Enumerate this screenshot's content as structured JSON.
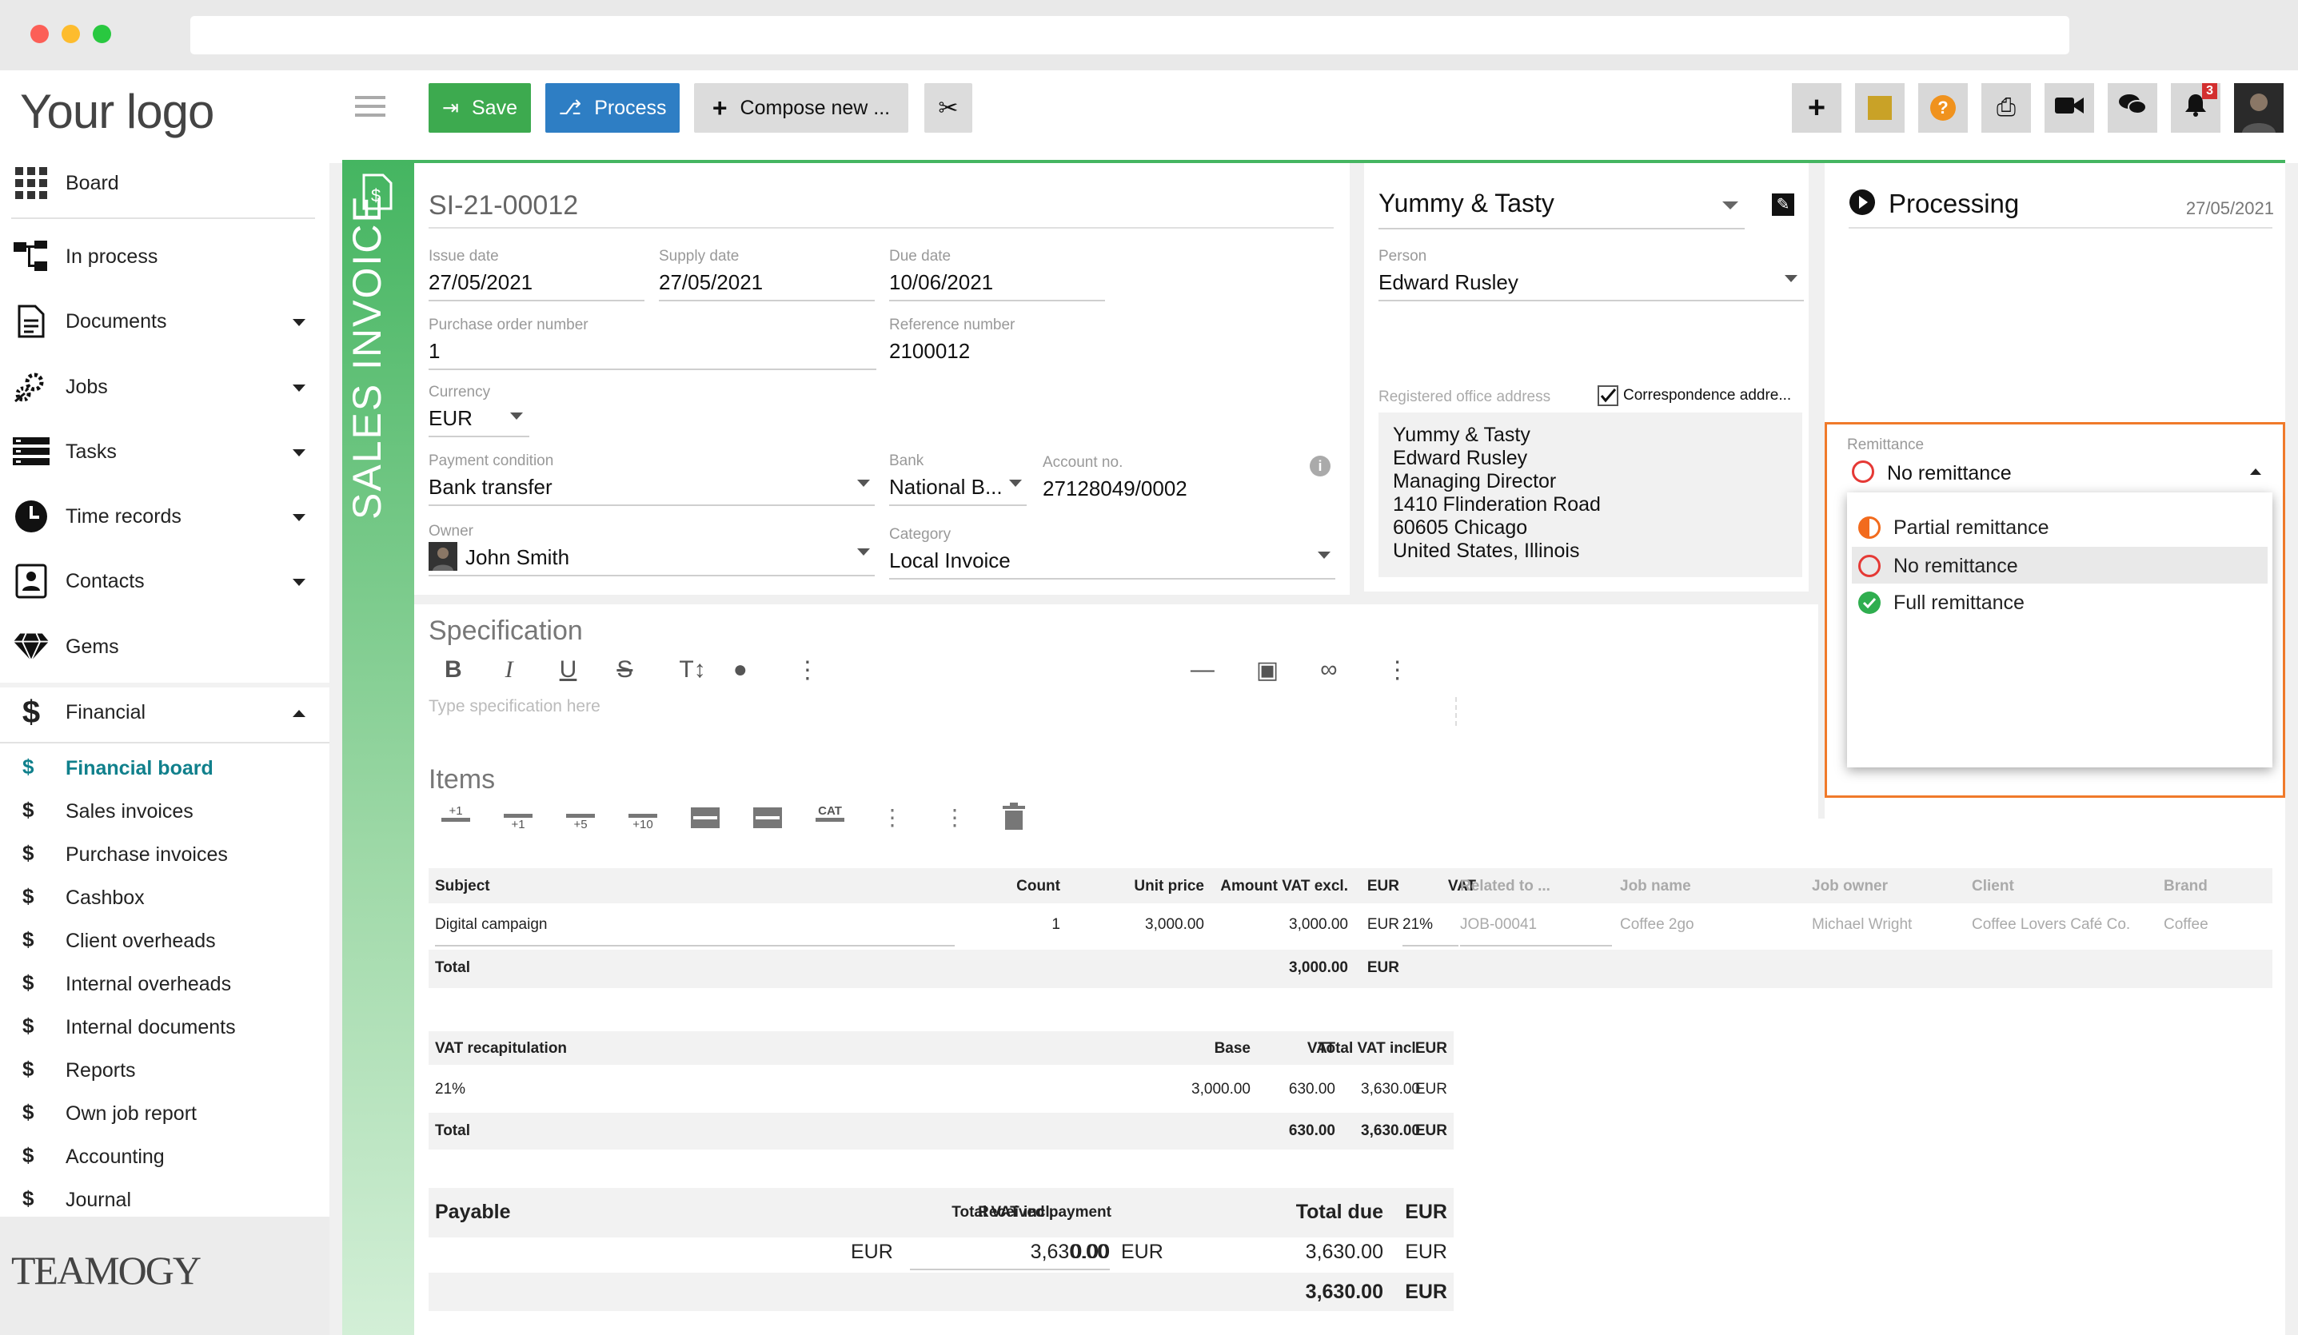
{
  "browser": {
    "url": ""
  },
  "sidebar": {
    "logo": "Your logo",
    "board": "Board",
    "items": [
      {
        "label": "In process",
        "icon": "process-icon"
      },
      {
        "label": "Documents",
        "icon": "document-icon"
      },
      {
        "label": "Jobs",
        "icon": "gears-icon"
      },
      {
        "label": "Tasks",
        "icon": "tasks-icon"
      },
      {
        "label": "Time records",
        "icon": "clock-icon"
      },
      {
        "label": "Contacts",
        "icon": "contacts-icon"
      },
      {
        "label": "Gems",
        "icon": "gem-icon"
      },
      {
        "label": "Financial",
        "icon": "dollar-icon"
      }
    ],
    "financial_items": [
      {
        "label": "Financial board"
      },
      {
        "label": "Sales invoices"
      },
      {
        "label": "Purchase invoices"
      },
      {
        "label": "Cashbox"
      },
      {
        "label": "Client overheads"
      },
      {
        "label": "Internal overheads"
      },
      {
        "label": "Internal documents"
      },
      {
        "label": "Reports"
      },
      {
        "label": "Own job report"
      },
      {
        "label": "Accounting"
      },
      {
        "label": "Journal"
      }
    ],
    "brand": "TEAMOGY"
  },
  "toolbar": {
    "save": "Save",
    "process": "Process",
    "compose": "Compose new ...",
    "notification_count": "3",
    "colors": {
      "save": "#3daa4f",
      "process": "#2e7ec4",
      "compose": "#dcdcdc"
    }
  },
  "invoice": {
    "tab_label": "SALES INVOICE",
    "number": "SI-21-00012",
    "issue_date": {
      "label": "Issue date",
      "value": "27/05/2021"
    },
    "supply_date": {
      "label": "Supply date",
      "value": "27/05/2021"
    },
    "due_date": {
      "label": "Due date",
      "value": "10/06/2021"
    },
    "po_number": {
      "label": "Purchase order number",
      "value": "1"
    },
    "reference": {
      "label": "Reference number",
      "value": "2100012"
    },
    "currency": {
      "label": "Currency",
      "value": "EUR"
    },
    "payment_condition": {
      "label": "Payment condition",
      "value": "Bank transfer"
    },
    "bank": {
      "label": "Bank",
      "value": "National B..."
    },
    "account": {
      "label": "Account no.",
      "value": "27128049/0002"
    },
    "owner": {
      "label": "Owner",
      "value": "John Smith"
    },
    "category": {
      "label": "Category",
      "value": "Local Invoice"
    }
  },
  "client": {
    "name": "Yummy & Tasty",
    "person_label": "Person",
    "person": "Edward Rusley",
    "registered_label": "Registered office address",
    "correspondence_label": "Correspondence addre...",
    "address": [
      "Yummy & Tasty",
      "Edward Rusley",
      "Managing Director",
      "1410 Flinderation Road",
      "60605 Chicago",
      "United States, Illinois"
    ]
  },
  "status": {
    "label": "Processing",
    "date": "27/05/2021",
    "remittance_label": "Remittance",
    "remittance_value": "No remittance",
    "options": [
      {
        "label": "Partial remittance"
      },
      {
        "label": "No remittance"
      },
      {
        "label": "Full remittance"
      }
    ],
    "colors": {
      "highlight": "#f07a2a",
      "partial": "#f26b1d",
      "none": "#e53935",
      "full": "#2fae4f"
    }
  },
  "specification": {
    "title": "Specification",
    "placeholder": "Type specification here"
  },
  "items": {
    "title": "Items",
    "toolbar_labels": {
      "add1": "+1",
      "add1b": "+1",
      "add5": "+5",
      "add10": "+10",
      "cat": "CAT"
    },
    "headers": {
      "subject": "Subject",
      "count": "Count",
      "unit_price": "Unit price",
      "amount": "Amount VAT excl.",
      "cur": "EUR",
      "vat": "VAT",
      "related": "Related to ...",
      "job_name": "Job name",
      "job_owner": "Job owner",
      "client": "Client",
      "brand": "Brand"
    },
    "rows": [
      {
        "subject": "Digital campaign",
        "count": "1",
        "unit_price": "3,000.00",
        "amount": "3,000.00",
        "cur": "EUR",
        "vat": "21%",
        "related": "JOB-00041",
        "job_name": "Coffee 2go",
        "job_owner": "Michael Wright",
        "client": "Coffee Lovers Café Co.",
        "brand": "Coffee"
      }
    ],
    "total_label": "Total",
    "total_amount": "3,000.00",
    "total_cur": "EUR"
  },
  "vat_recap": {
    "title": "VAT recapitulation",
    "headers": {
      "base": "Base",
      "vat": "VAT",
      "total": "Total VAT incl.",
      "cur": "EUR"
    },
    "row": {
      "rate": "21%",
      "base": "3,000.00",
      "vat": "630.00",
      "total": "3,630.00",
      "cur": "EUR"
    },
    "total_label": "Total",
    "total": {
      "vat": "630.00",
      "total": "3,630.00",
      "cur": "EUR"
    }
  },
  "payable": {
    "title": "Payable",
    "total_label": "Total VAT incl.",
    "received_label": "Received payment",
    "due_label": "Total due",
    "cur": "EUR",
    "total": "3,630.00",
    "received": "0.00",
    "due": "3,630.00",
    "grand": "3,630.00"
  }
}
